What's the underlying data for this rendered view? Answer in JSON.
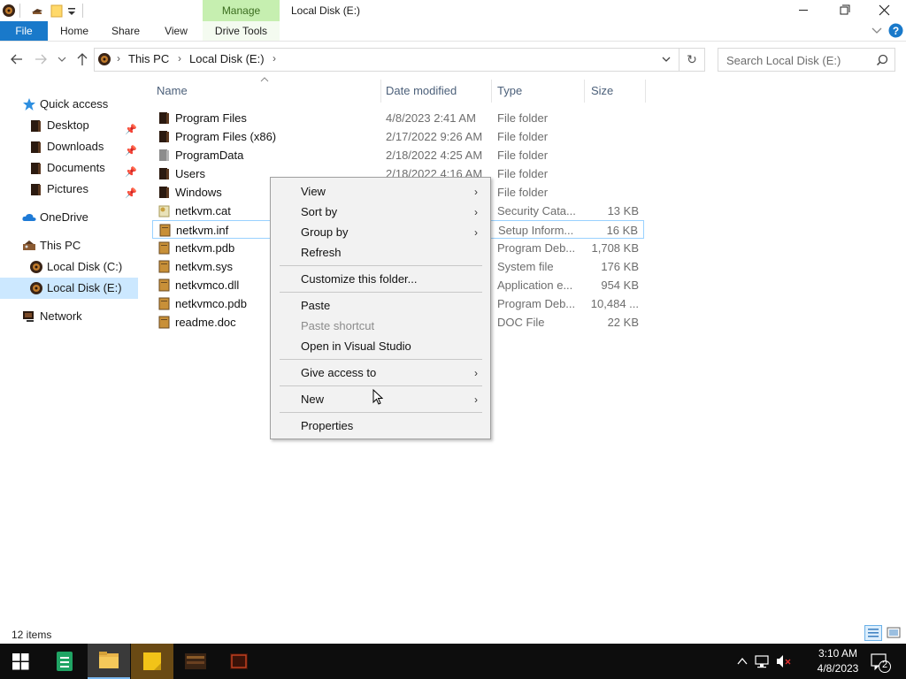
{
  "window": {
    "title": "Local Disk (E:)",
    "manage_label": "Manage"
  },
  "ribbon": {
    "tabs": [
      "File",
      "Home",
      "Share",
      "View",
      "Drive Tools"
    ]
  },
  "address": {
    "segments": [
      "This PC",
      "Local Disk (E:)"
    ],
    "search_placeholder": "Search Local Disk (E:)"
  },
  "nav": {
    "quick_access": "Quick access",
    "desktop": "Desktop",
    "downloads": "Downloads",
    "documents": "Documents",
    "pictures": "Pictures",
    "onedrive": "OneDrive",
    "this_pc": "This PC",
    "local_c": "Local Disk (C:)",
    "local_e": "Local Disk (E:)",
    "network": "Network"
  },
  "columns": {
    "name": "Name",
    "date": "Date modified",
    "type": "Type",
    "size": "Size"
  },
  "files": [
    {
      "name": "Program Files",
      "date": "4/8/2023 2:41 AM",
      "type": "File folder",
      "size": ""
    },
    {
      "name": "Program Files (x86)",
      "date": "2/17/2022 9:26 AM",
      "type": "File folder",
      "size": ""
    },
    {
      "name": "ProgramData",
      "date": "2/18/2022 4:25 AM",
      "type": "File folder",
      "size": ""
    },
    {
      "name": "Users",
      "date": "2/18/2022 4:16 AM",
      "type": "File folder",
      "size": ""
    },
    {
      "name": "Windows",
      "date": "",
      "type": "File folder",
      "size": ""
    },
    {
      "name": "netkvm.cat",
      "date": "",
      "type": "Security Cata...",
      "size": "13 KB"
    },
    {
      "name": "netkvm.inf",
      "date": "",
      "type": "Setup Inform...",
      "size": "16 KB"
    },
    {
      "name": "netkvm.pdb",
      "date": "",
      "type": "Program Deb...",
      "size": "1,708 KB"
    },
    {
      "name": "netkvm.sys",
      "date": "",
      "type": "System file",
      "size": "176 KB"
    },
    {
      "name": "netkvmco.dll",
      "date": "",
      "type": "Application e...",
      "size": "954 KB"
    },
    {
      "name": "netkvmco.pdb",
      "date": "",
      "type": "Program Deb...",
      "size": "10,484 ..."
    },
    {
      "name": "readme.doc",
      "date": "",
      "type": "DOC File",
      "size": "22 KB"
    }
  ],
  "context_menu": {
    "view": "View",
    "sort_by": "Sort by",
    "group_by": "Group by",
    "refresh": "Refresh",
    "customize": "Customize this folder...",
    "paste": "Paste",
    "paste_shortcut": "Paste shortcut",
    "open_vs": "Open in Visual Studio",
    "give_access": "Give access to",
    "new": "New",
    "properties": "Properties"
  },
  "status": {
    "item_count": "12 items"
  },
  "taskbar": {
    "time": "3:10 AM",
    "date": "4/8/2023",
    "notification_count": "2"
  },
  "colors": {
    "file_tab": "#1979ca",
    "manage_tab": "#c6efb0",
    "selected_nav": "#cce8ff",
    "row_focus_border": "#99d1ff",
    "taskbar": "#0d0d0d"
  }
}
